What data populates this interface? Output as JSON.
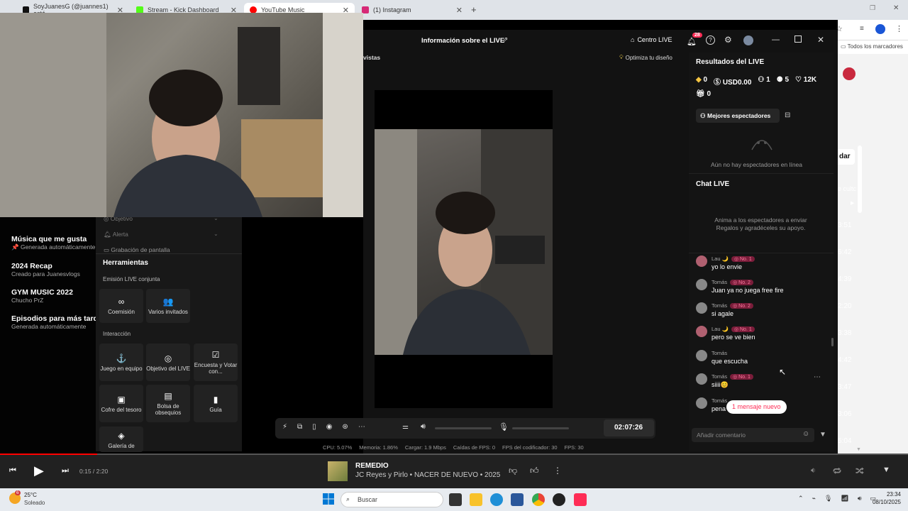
{
  "browser": {
    "tabs": [
      {
        "label": "SoyJuanesG (@juannes1) está",
        "color": "#111111"
      },
      {
        "label": "Stream - Kick Dashboard",
        "color": "#53fc18"
      },
      {
        "label": "YouTube Music",
        "color": "#ff0000"
      },
      {
        "label": "(1) Instagram",
        "color": "#d62976"
      }
    ],
    "bookmarks_label": "Todos los marcadores",
    "new_tab": "+"
  },
  "ytmusic_left": {
    "partial_items": [
      "Objetivo",
      "Alerta",
      "Grabación de pantalla"
    ],
    "playlists": [
      {
        "title": "Música que me gusta",
        "subtitle": "Generada automáticamente",
        "pin": "📌"
      },
      {
        "title": "2024 Recap",
        "subtitle": "Creado para Juanesvlogs"
      },
      {
        "title": "GYM MUSIC 2022",
        "subtitle": "Chucho PrZ"
      },
      {
        "title": "Episodios para más tarde",
        "subtitle": "Generada automáticamente"
      }
    ]
  },
  "kick_right": {
    "button": "dar",
    "text": "e cultc",
    "durations": [
      "3:51",
      "6:42",
      "4:39",
      "2:20",
      "3:38",
      "4:42",
      "3:47",
      "3:06",
      "5:04"
    ]
  },
  "studio": {
    "header_title": "Información sobre el LIVE",
    "side_tab": "vistas",
    "center_live": "Centro LIVE",
    "notif_count": "28",
    "optimize": "Optimiza tu diseño",
    "tools": {
      "title": "Herramientas",
      "coop_heading": "Emisión LIVE conjunta",
      "coop": [
        {
          "label": "Coemisión",
          "icon": "∞"
        },
        {
          "label": "Varios invitados",
          "icon": "👥"
        }
      ],
      "interaction_heading": "Interacción",
      "interaction": [
        {
          "label": "Juego en equipo",
          "icon": "⚓"
        },
        {
          "label": "Objetivo del LIVE",
          "icon": "◎"
        },
        {
          "label": "Encuesta y Votar con...",
          "icon": "☑"
        },
        {
          "label": "Cofre del tesoro",
          "icon": "▣"
        },
        {
          "label": "Bolsa de obsequios",
          "icon": "▤"
        },
        {
          "label": "Guía",
          "icon": "▮"
        },
        {
          "label": "Galería de",
          "icon": "◈"
        }
      ]
    },
    "timer": "02:07:26",
    "stats": {
      "cpu": "CPU: 5.07%",
      "mem": "Memoria: 1.86%",
      "upload": "Cargar: 1.9 Mbps",
      "drops": "Caídas de FPS: 0",
      "enc": "FPS del codificador: 30",
      "fps": "FPS: 30"
    },
    "results": {
      "title": "Resultados del LIVE",
      "diamonds": "0",
      "usd": "USD0.00",
      "v1": "1",
      "v2": "5",
      "likes": "12K",
      "gifts": "0"
    },
    "top_viewers": {
      "button": "Mejores espectadores",
      "empty": "Aún no hay espectadores en línea"
    },
    "chat": {
      "title": "Chat LIVE",
      "hint": "Anima a los espectadores a enviar Regalos y agradéceles su apoyo.",
      "new_message": "1 mensaje nuevo",
      "placeholder": "Añadir comentario",
      "messages": [
        {
          "name": "Lau 🌙",
          "badge": "No. 1",
          "text": "yo lo envie"
        },
        {
          "name": "Tomás",
          "badge": "No. 2",
          "text": "Juan ya no juega free fire"
        },
        {
          "name": "Tomás",
          "badge": "No. 2",
          "text": "si agale"
        },
        {
          "name": "Lau 🌙",
          "badge": "No. 1",
          "text": "pero se ve bien"
        },
        {
          "name": "Tomás",
          "badge": "",
          "text": "que escucha"
        },
        {
          "name": "Tomás",
          "badge": "No. 1",
          "text": "siiii😊"
        },
        {
          "name": "Tomás",
          "badge": "",
          "text": "pena"
        }
      ]
    }
  },
  "player": {
    "time": "0:15 / 2:20",
    "progress": 0.107,
    "song": "REMEDIO",
    "artist": "JC Reyes y Pirlo • NACER DE NUEVO • 2025"
  },
  "taskbar": {
    "weather_temp": "25°C",
    "weather_desc": "Soleado",
    "weather_badge": "6",
    "search": "Buscar",
    "time": "23:34",
    "date": "08/10/2025"
  }
}
